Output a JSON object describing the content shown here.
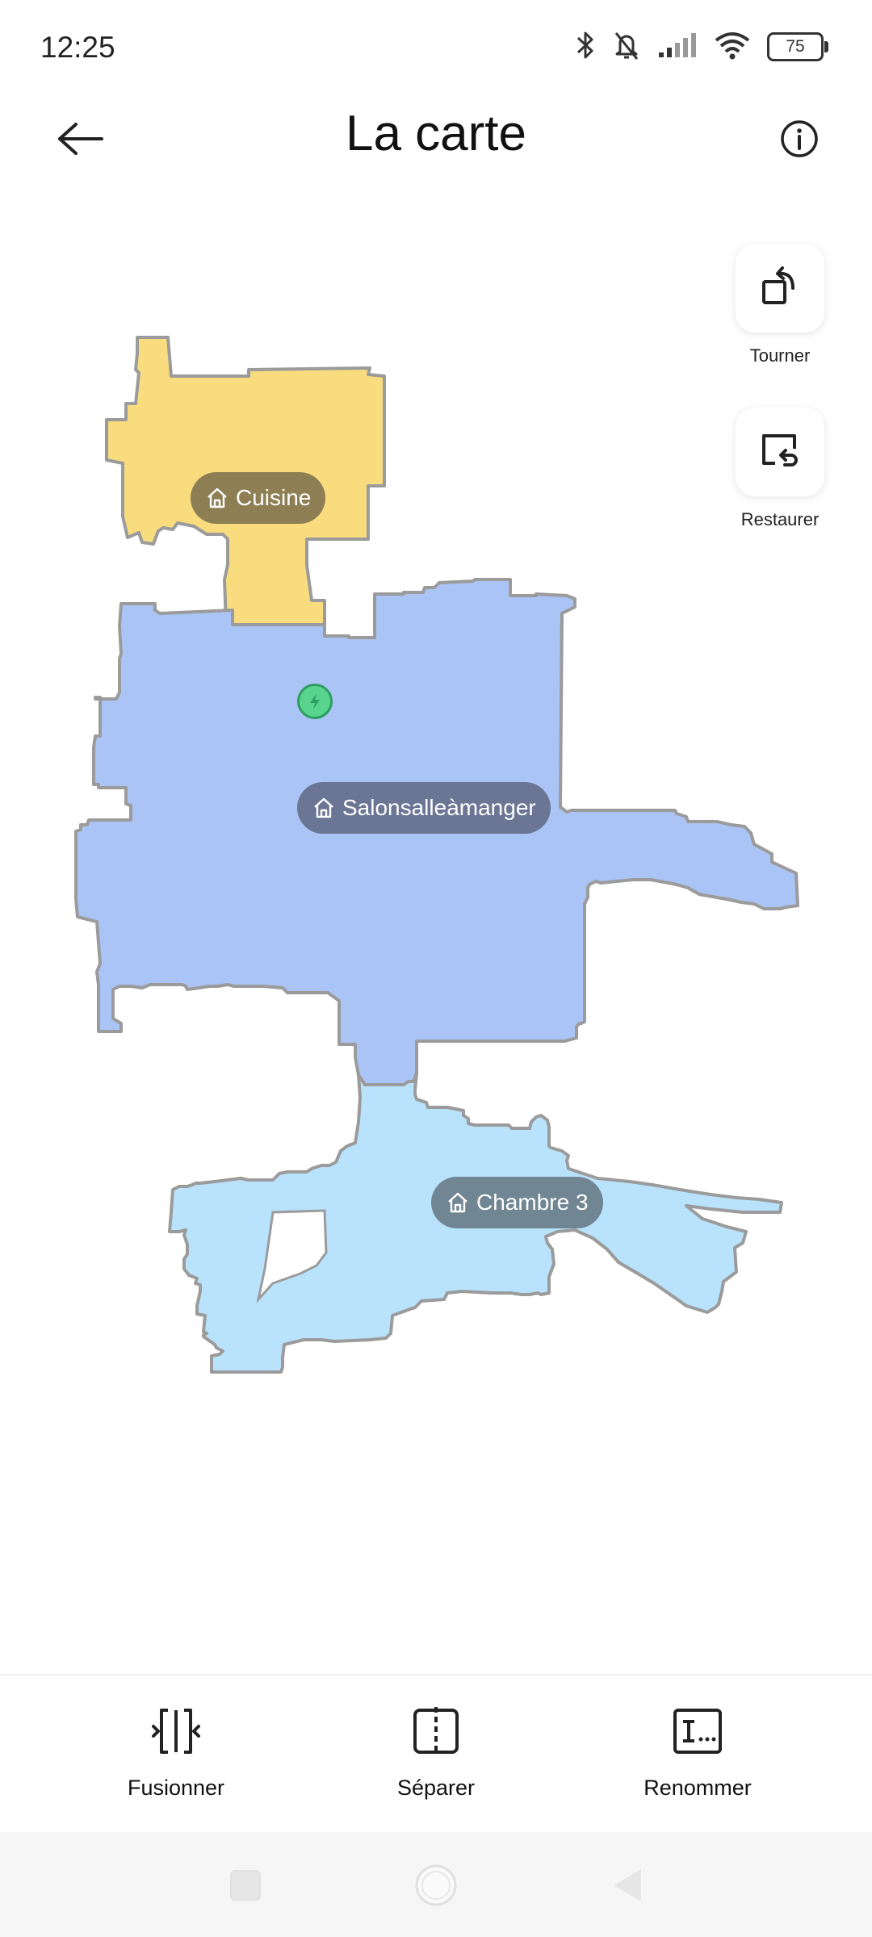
{
  "status_bar": {
    "time": "12:25",
    "battery_level": "75",
    "icons": [
      "bluetooth-icon",
      "bell-muted-icon",
      "signal-icon",
      "wifi-icon",
      "battery-icon"
    ]
  },
  "header": {
    "title": "La carte",
    "back_icon": "arrow-left-icon",
    "info_icon": "info-icon"
  },
  "map": {
    "rooms": [
      {
        "id": "kitchen",
        "label": "Cuisine",
        "color": "#F8DC7E"
      },
      {
        "id": "living",
        "label": "Salonsalleàmanger",
        "color": "#AAC4F5"
      },
      {
        "id": "bedroom",
        "label": "Chambre 3",
        "color": "#B9E3FC"
      }
    ],
    "outline_color": "#9B9B9B",
    "dock_color": "#59D48E"
  },
  "side_tools": {
    "rotate": {
      "label": "Tourner",
      "icon": "rotate-icon"
    },
    "restore": {
      "label": "Restaurer",
      "icon": "restore-icon"
    }
  },
  "bottom_actions": {
    "merge": {
      "label": "Fusionner",
      "icon": "merge-icon"
    },
    "split": {
      "label": "Séparer",
      "icon": "split-icon"
    },
    "rename": {
      "label": "Renommer",
      "icon": "rename-icon"
    }
  },
  "nav_bar": {
    "recents_icon": "square-icon",
    "home_icon": "circle-icon",
    "back_icon": "triangle-back-icon"
  }
}
